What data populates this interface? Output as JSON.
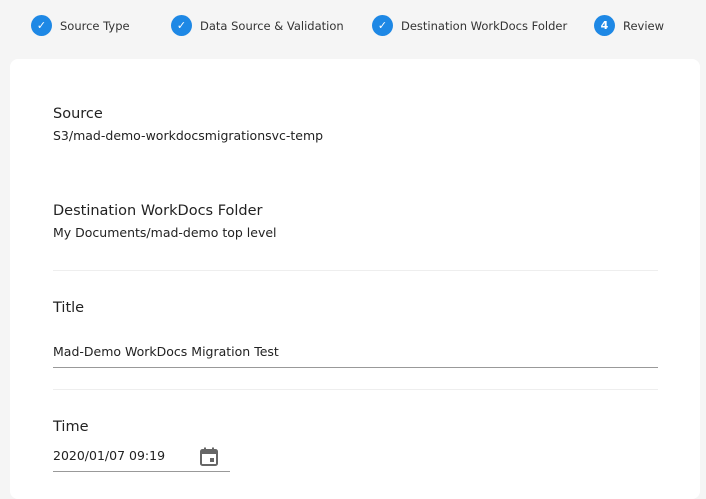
{
  "steps": [
    {
      "label": "Source Type",
      "status": "done"
    },
    {
      "label": "Data Source & Validation",
      "status": "done"
    },
    {
      "label": "Destination WorkDocs Folder",
      "status": "done"
    },
    {
      "label": "Review",
      "number": "4",
      "status": "current"
    }
  ],
  "source": {
    "label": "Source",
    "value": "S3/mad-demo-workdocsmigrationsvc-temp"
  },
  "destination": {
    "label": "Destination WorkDocs Folder",
    "value": "My Documents/mad-demo top level"
  },
  "title": {
    "label": "Title",
    "value": "Mad-Demo WorkDocs Migration Test"
  },
  "time": {
    "label": "Time",
    "value": "2020/01/07 09:19"
  },
  "accent": "#1e88e5"
}
